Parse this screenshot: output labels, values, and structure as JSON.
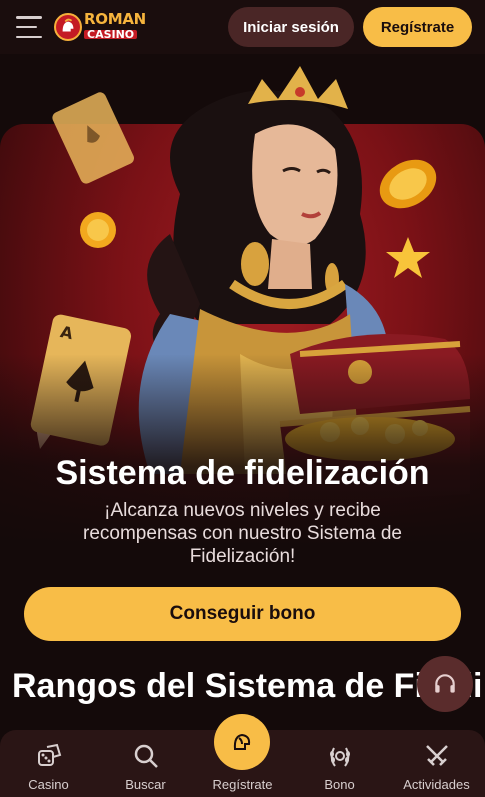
{
  "header": {
    "logo_top": "ROMAN",
    "logo_bottom": "CASINO",
    "login_label": "Iniciar sesión",
    "register_label": "Regístrate"
  },
  "hero": {
    "title": "Sistema de fidelización",
    "subtitle": "¡Alcanza nuevos niveles y recibe recompensas con nuestro Sistema de Fidelización!",
    "cta_label": "Conseguir bono"
  },
  "section": {
    "title": "Rangos del Sistema de Fidelización"
  },
  "bottom_nav": {
    "items": [
      {
        "label": "Casino",
        "icon": "dice-icon"
      },
      {
        "label": "Buscar",
        "icon": "search-icon"
      },
      {
        "label": "Regístrate",
        "icon": "helmet-icon"
      },
      {
        "label": "Bono",
        "icon": "laurel-icon"
      },
      {
        "label": "Actividades",
        "icon": "swords-icon"
      }
    ]
  },
  "colors": {
    "accent": "#f8bd47",
    "background": "#140a0a",
    "hero_red": "#a31c22",
    "nav_bg": "#2a1515"
  }
}
